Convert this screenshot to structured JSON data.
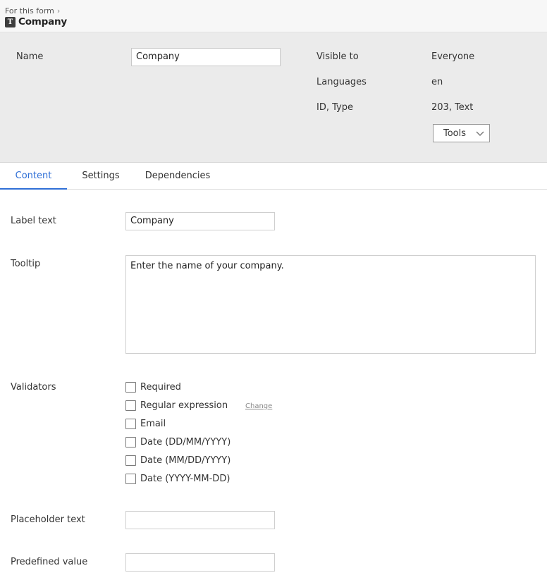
{
  "header": {
    "breadcrumb": "For this form",
    "type_badge": "T",
    "title": "Company"
  },
  "properties": {
    "name_label": "Name",
    "name_value": "Company",
    "visible_label": "Visible to",
    "visible_value": "Everyone",
    "languages_label": "Languages",
    "languages_value": "en",
    "id_type_label": "ID, Type",
    "id_type_value": "203, Text",
    "tools_label": "Tools"
  },
  "tabs": [
    {
      "label": "Content",
      "active": true
    },
    {
      "label": "Settings",
      "active": false
    },
    {
      "label": "Dependencies",
      "active": false
    }
  ],
  "content": {
    "label_text_label": "Label text",
    "label_text_value": "Company",
    "tooltip_label": "Tooltip",
    "tooltip_value": "Enter the name of your company.",
    "validators_label": "Validators",
    "validators": [
      {
        "label": "Required",
        "checked": false
      },
      {
        "label": "Regular expression",
        "checked": false
      },
      {
        "label": "Email",
        "checked": false
      },
      {
        "label": "Date (DD/MM/YYYY)",
        "checked": false
      },
      {
        "label": "Date (MM/DD/YYYY)",
        "checked": false
      },
      {
        "label": "Date (YYYY-MM-DD)",
        "checked": false
      }
    ],
    "change_link": "Change",
    "placeholder_label": "Placeholder text",
    "placeholder_value": "",
    "predefined_label": "Predefined value",
    "predefined_value": ""
  },
  "colors": {
    "accent": "#2f6fd6",
    "panel_bg": "#ebebeb",
    "header_bg": "#f7f7f7"
  }
}
